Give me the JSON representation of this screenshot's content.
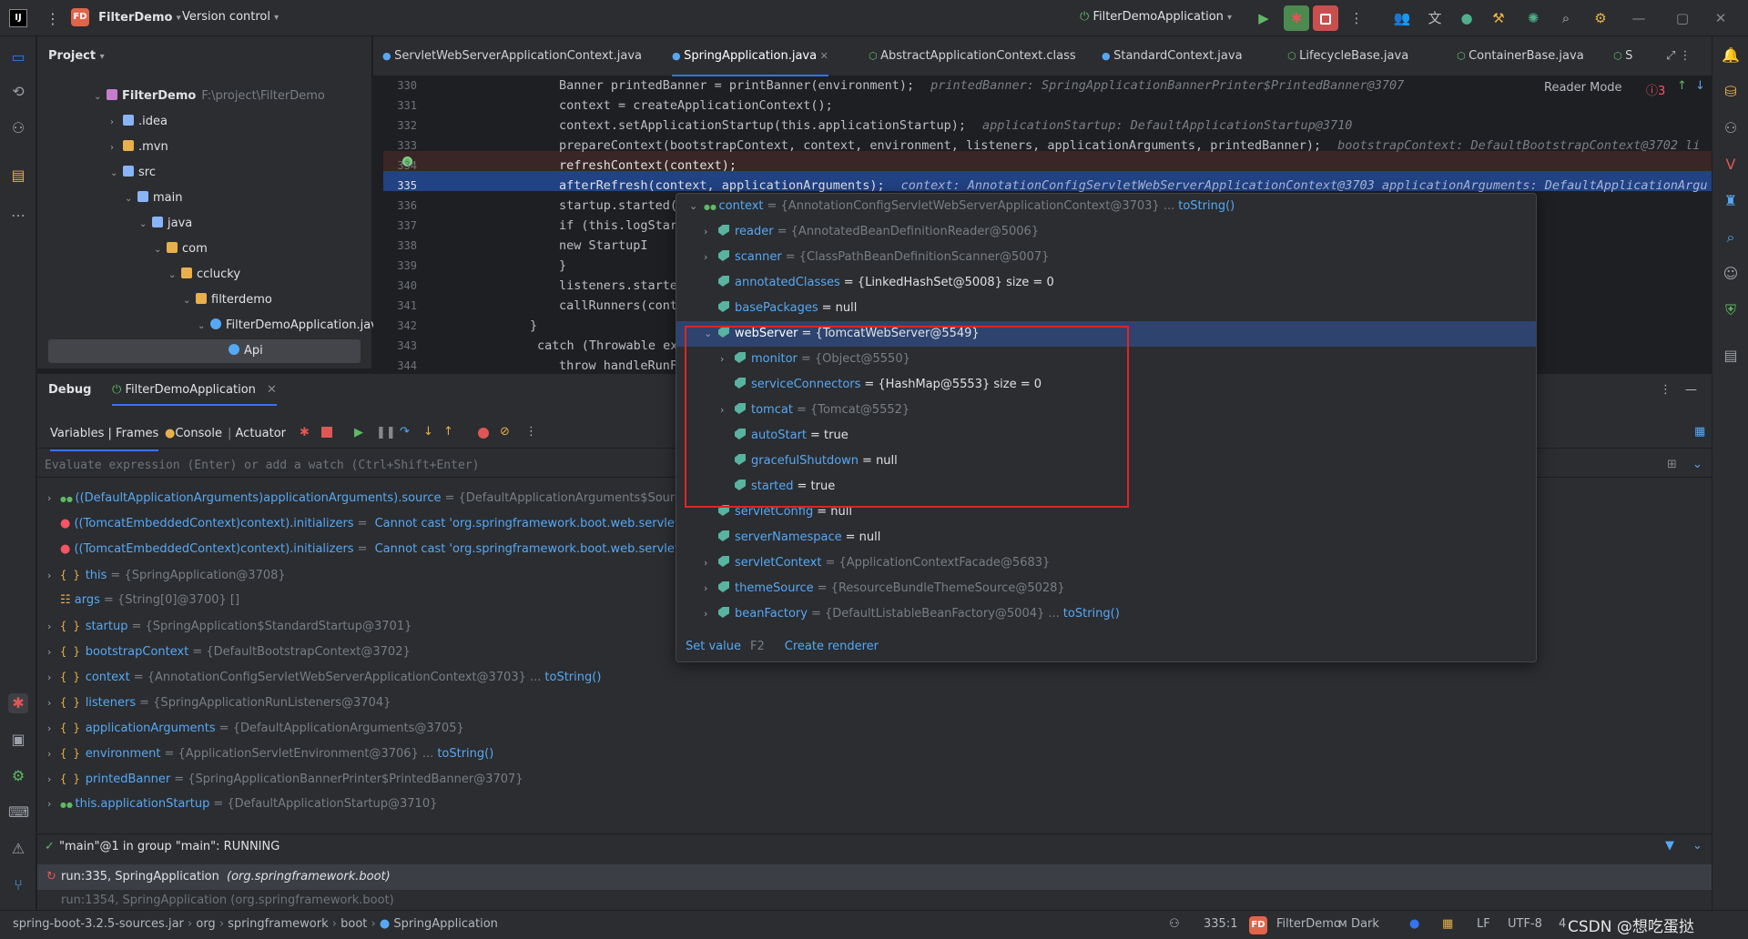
{
  "titlebar": {
    "project_badge": "FD",
    "project_name": "FilterDemo",
    "vcs": "Version control",
    "run_config": "FilterDemoApplication"
  },
  "project_panel": {
    "title": "Project",
    "tree": [
      {
        "label": "FilterDemo",
        "hint": "F:\\project\\FilterDemo"
      },
      {
        "label": ".idea"
      },
      {
        "label": ".mvn"
      },
      {
        "label": "src"
      },
      {
        "label": "main"
      },
      {
        "label": "java"
      },
      {
        "label": "com"
      },
      {
        "label": "cclucky"
      },
      {
        "label": "filterdemo"
      },
      {
        "label": "FilterDemoApplication.java"
      },
      {
        "label": "Api"
      }
    ]
  },
  "tabs": [
    {
      "label": "ServletWebServerApplicationContext.java"
    },
    {
      "label": "SpringApplication.java"
    },
    {
      "label": "AbstractApplicationContext.class"
    },
    {
      "label": "StandardContext.java"
    },
    {
      "label": "LifecycleBase.java"
    },
    {
      "label": "ContainerBase.java"
    },
    {
      "label": "S"
    }
  ],
  "editor": {
    "reader_mode": "Reader Mode",
    "problems": "3",
    "lines": [
      {
        "num": "330",
        "code": "Banner printedBanner = printBanner(environment);",
        "hint": "printedBanner: SpringApplicationBannerPrinter$PrintedBanner@3707"
      },
      {
        "num": "331",
        "code": "context = createApplicationContext();",
        "hint": ""
      },
      {
        "num": "332",
        "code": "context.setApplicationStartup(this.applicationStartup);",
        "hint": "applicationStartup: DefaultApplicationStartup@3710"
      },
      {
        "num": "333",
        "code": "prepareContext(bootstrapContext, context, environment, listeners, applicationArguments, printedBanner);",
        "hint": "bootstrapContext: DefaultBootstrapContext@3702   li"
      },
      {
        "num": "334",
        "code": "refreshContext(context);",
        "hint": ""
      },
      {
        "num": "335",
        "code": "afterRefresh(context, applicationArguments);",
        "hint": "context: AnnotationConfigServletWebServerApplicationContext@3703    applicationArguments: DefaultApplicationArgu"
      },
      {
        "num": "336",
        "code": "startup.started(",
        "hint": ""
      },
      {
        "num": "337",
        "code": "if (this.logStar",
        "hint": ""
      },
      {
        "num": "338",
        "code": "    new StartupI",
        "hint": ""
      },
      {
        "num": "339",
        "code": "}",
        "hint": ""
      },
      {
        "num": "340",
        "code": "listeners.starte",
        "hint": ""
      },
      {
        "num": "341",
        "code": "callRunners(cont",
        "hint": ""
      },
      {
        "num": "342",
        "code": "}",
        "hint": ""
      },
      {
        "num": "343",
        "code": "catch (Throwable ex",
        "hint": ""
      },
      {
        "num": "344",
        "code": "throw handleRunF",
        "hint": ""
      }
    ]
  },
  "debug": {
    "tab_debug": "Debug",
    "tab_app": "FilterDemoApplication",
    "subtabs": "Variables | Frames",
    "console": "Console",
    "actuator": "Actuator",
    "eval_placeholder": "Evaluate expression (Enter) or add a watch (Ctrl+Shift+Enter)",
    "vars": [
      {
        "name": "((DefaultApplicationArguments)applicationArguments).source",
        "val": "= {DefaultApplicationArguments$Source@",
        "link": ""
      },
      {
        "name": "((TomcatEmbeddedContext)context).initializers",
        "val": "= ",
        "link": "Cannot cast 'org.springframework.boot.web.servlet.c"
      },
      {
        "name": "((TomcatEmbeddedContext)context).initializers",
        "val": "= ",
        "link": "Cannot cast 'org.springframework.boot.web.servlet.c"
      },
      {
        "name": "this",
        "val": "= {SpringApplication@3708}",
        "link": ""
      },
      {
        "name": "args",
        "val": "= {String[0]@3700} []",
        "link": ""
      },
      {
        "name": "startup",
        "val": "= {SpringApplication$StandardStartup@3701}",
        "link": ""
      },
      {
        "name": "bootstrapContext",
        "val": "= {DefaultBootstrapContext@3702}",
        "link": ""
      },
      {
        "name": "context",
        "val": "= {AnnotationConfigServletWebServerApplicationContext@3703} ...",
        "link": "toString()"
      },
      {
        "name": "listeners",
        "val": "= {SpringApplicationRunListeners@3704}",
        "link": ""
      },
      {
        "name": "applicationArguments",
        "val": "= {DefaultApplicationArguments@3705}",
        "link": ""
      },
      {
        "name": "environment",
        "val": "= {ApplicationServletEnvironment@3706} ...",
        "link": "toString()"
      },
      {
        "name": "printedBanner",
        "val": "= {SpringApplicationBannerPrinter$PrintedBanner@3707}",
        "link": ""
      },
      {
        "name": "this.applicationStartup",
        "val": "= {DefaultApplicationStartup@3710}",
        "link": ""
      }
    ],
    "thread": "\"main\"@1 in group \"main\": RUNNING",
    "frame1": "run:335, SpringApplication",
    "frame1_pkg": "(org.springframework.boot)",
    "frame2": "run:1354, SpringApplication (org.springframework.boot)"
  },
  "popup": {
    "rows": [
      {
        "name": "context",
        "val": "= {AnnotationConfigServletWebServerApplicationContext@3703} ...",
        "link": "toString()"
      },
      {
        "name": "reader",
        "val": "= {AnnotatedBeanDefinitionReader@5006}",
        "link": ""
      },
      {
        "name": "scanner",
        "val": "= {ClassPathBeanDefinitionScanner@5007}",
        "link": ""
      },
      {
        "name": "annotatedClasses",
        "val": "= {LinkedHashSet@5008}  size = 0",
        "link": ""
      },
      {
        "name": "basePackages",
        "val": "= null",
        "link": ""
      },
      {
        "name": "webServer",
        "val": "= {TomcatWebServer@5549}",
        "link": ""
      },
      {
        "name": "monitor",
        "val": "= {Object@5550}",
        "link": ""
      },
      {
        "name": "serviceConnectors",
        "val": "= {HashMap@5553}  size = 0",
        "link": ""
      },
      {
        "name": "tomcat",
        "val": "= {Tomcat@5552}",
        "link": ""
      },
      {
        "name": "autoStart",
        "val": "= true",
        "link": ""
      },
      {
        "name": "gracefulShutdown",
        "val": "= null",
        "link": ""
      },
      {
        "name": "started",
        "val": "= true",
        "link": ""
      },
      {
        "name": "servletConfig",
        "val": "= null",
        "link": ""
      },
      {
        "name": "serverNamespace",
        "val": "= null",
        "link": ""
      },
      {
        "name": "servletContext",
        "val": "= {ApplicationContextFacade@5683}",
        "link": ""
      },
      {
        "name": "themeSource",
        "val": "= {ResourceBundleThemeSource@5028}",
        "link": ""
      },
      {
        "name": "beanFactory",
        "val": "= {DefaultListableBeanFactory@5004} ...",
        "link": "toString()"
      }
    ],
    "set_value": "Set value",
    "set_value_key": "F2",
    "create_renderer": "Create renderer"
  },
  "statusbar": {
    "crumbs": [
      "spring-boot-3.2.5-sources.jar",
      "org",
      "springframework",
      "boot",
      "SpringApplication"
    ],
    "pos": "335:1",
    "project": "FilterDemo",
    "theme": "Dark",
    "lf": "LF",
    "enc": "UTF-8",
    "indent": "4",
    "watermark": "CSDN @想吃蛋挞"
  }
}
